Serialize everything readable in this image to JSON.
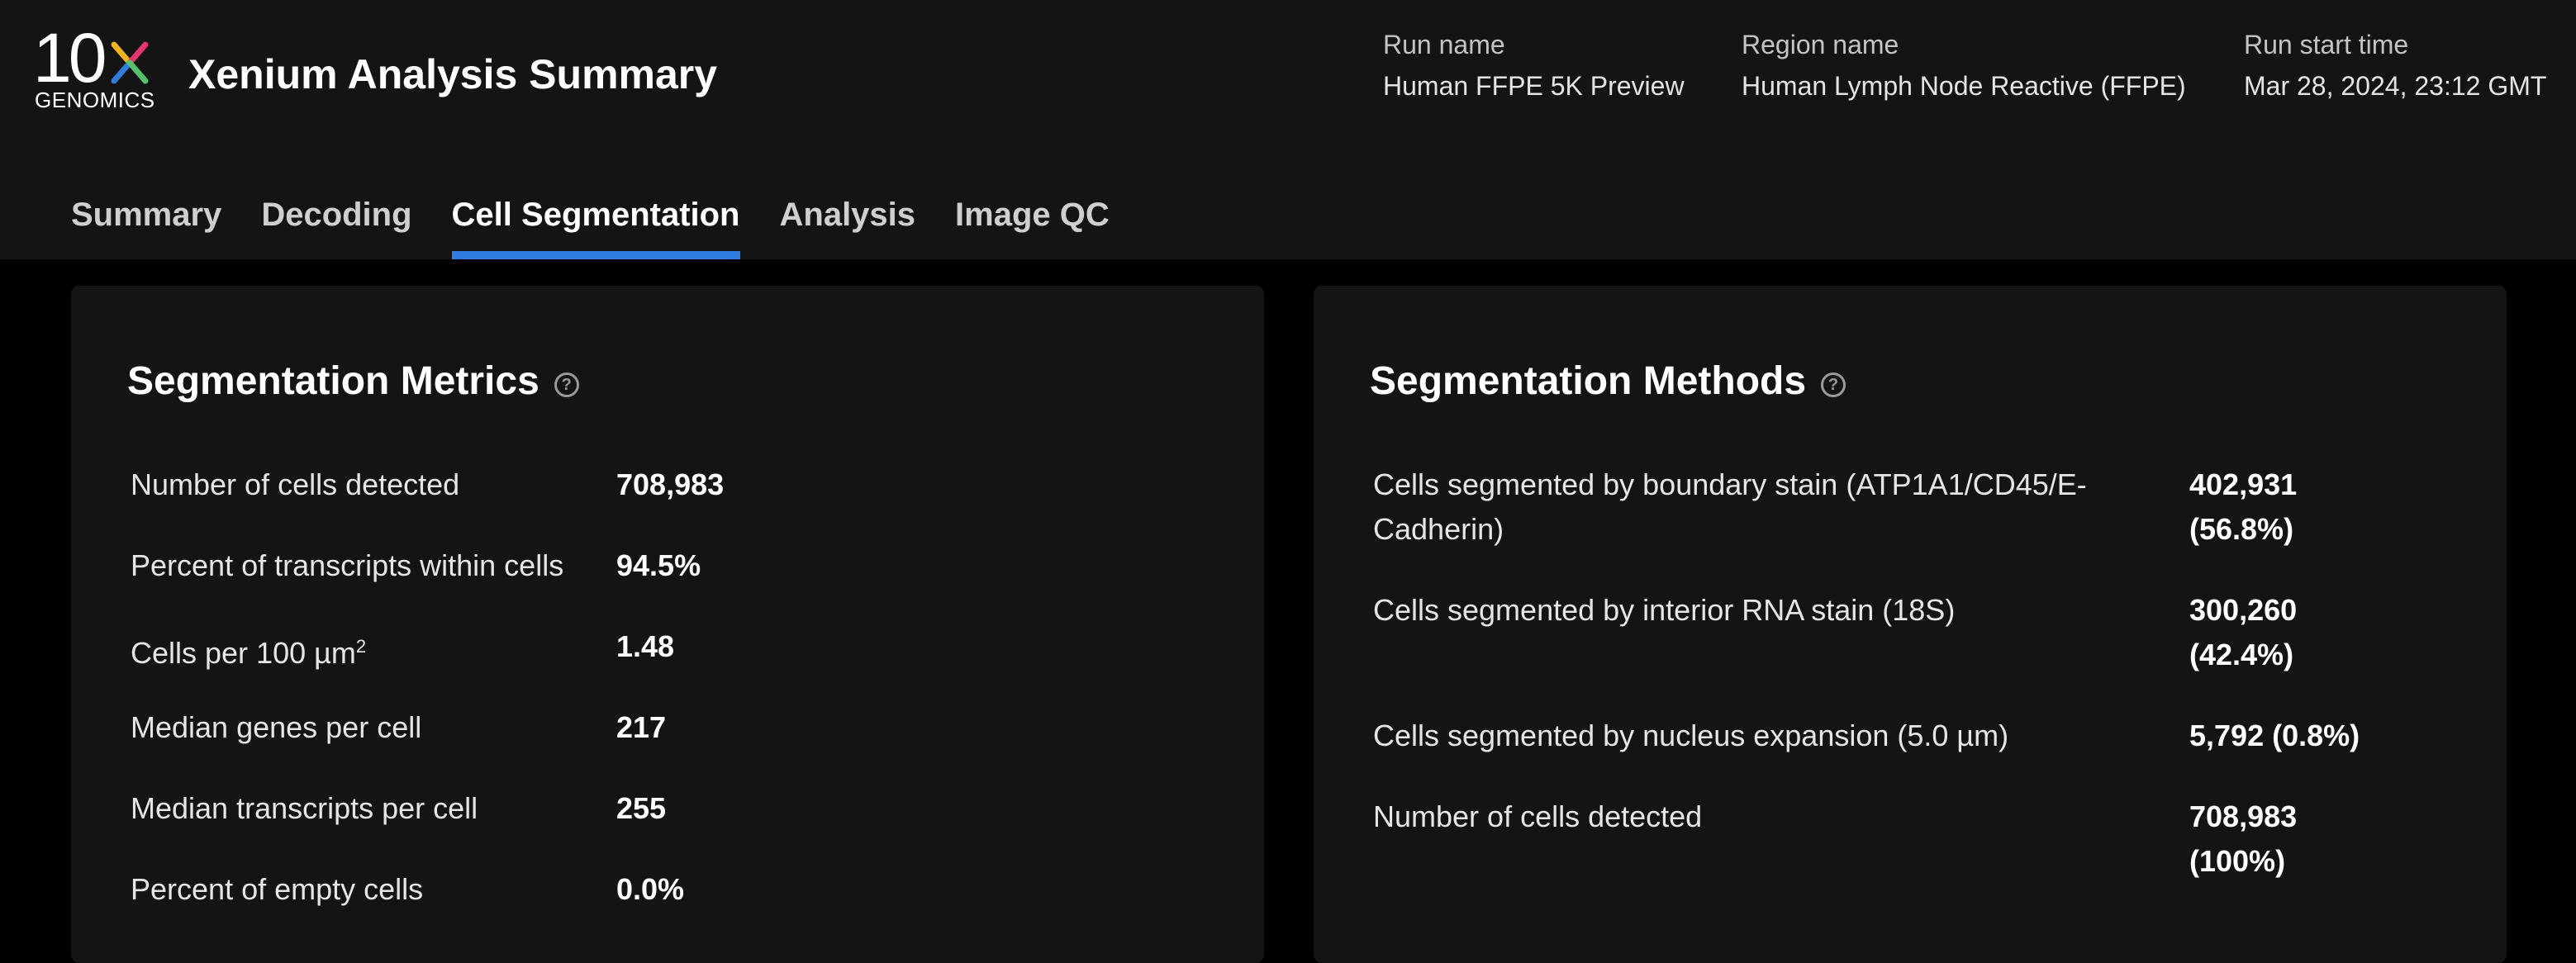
{
  "brand": {
    "logo_number": "10",
    "logo_letter": "X",
    "logo_word": "GENOMICS",
    "logo_colors": [
      "#f1b51c",
      "#e6356f",
      "#2f7de1",
      "#55c26b"
    ]
  },
  "header": {
    "title": "Xenium Analysis Summary",
    "run_name_label": "Run name",
    "run_name": "Human FFPE 5K Preview",
    "region_name_label": "Region name",
    "region_name": "Human Lymph Node Reactive (FFPE)",
    "run_start_label": "Run start time",
    "run_start": "Mar 28, 2024, 23:12 GMT"
  },
  "tabs": [
    {
      "label": "Summary",
      "active": false
    },
    {
      "label": "Decoding",
      "active": false
    },
    {
      "label": "Cell Segmentation",
      "active": true
    },
    {
      "label": "Analysis",
      "active": false
    },
    {
      "label": "Image QC",
      "active": false
    }
  ],
  "accent_color": "#2f7de1",
  "segmentation_metrics": {
    "title": "Segmentation Metrics",
    "help_icon": "question-circle-icon",
    "rows": [
      {
        "label": "Number of cells detected",
        "value": "708,983"
      },
      {
        "label": "Percent of transcripts within cells",
        "value": "94.5%"
      },
      {
        "label": "Cells per 100 µm",
        "label_sup": "2",
        "value": "1.48"
      },
      {
        "label": "Median genes per cell",
        "value": "217"
      },
      {
        "label": "Median transcripts per cell",
        "value": "255"
      },
      {
        "label": "Percent of empty cells",
        "value": "0.0%"
      }
    ]
  },
  "segmentation_methods": {
    "title": "Segmentation Methods",
    "help_icon": "question-circle-icon",
    "rows": [
      {
        "label_line1": "Cells segmented by boundary stain (ATP1A1/CD45/E-",
        "label_line2": "Cadherin)",
        "value_line1": "402,931",
        "value_line2": "(56.8%)"
      },
      {
        "label_line1": "Cells segmented by interior RNA stain (18S)",
        "label_line2": "",
        "value_line1": "300,260",
        "value_line2": "(42.4%)"
      },
      {
        "label_line1": "Cells segmented by nucleus expansion (5.0 µm)",
        "label_line2": "",
        "value_line1": "5,792 (0.8%)",
        "value_line2": ""
      },
      {
        "label_line1": "Number of cells detected",
        "label_line2": "",
        "value_line1": "708,983",
        "value_line2": "(100%)"
      }
    ]
  }
}
